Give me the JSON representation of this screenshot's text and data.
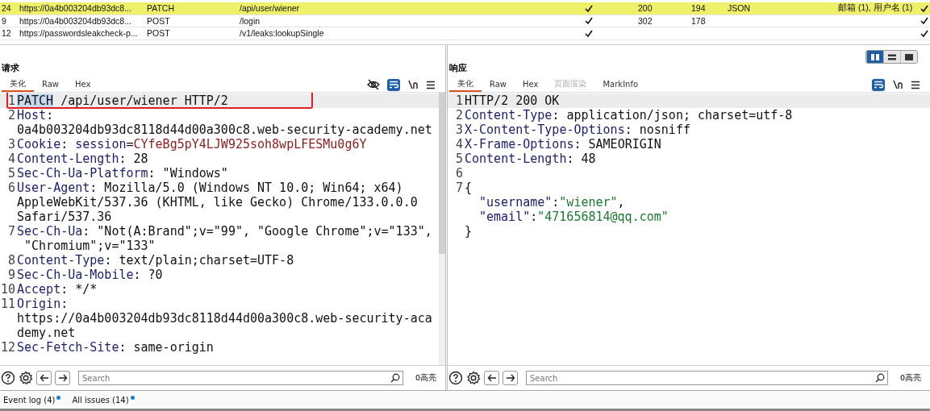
{
  "history": {
    "rows": [
      {
        "num": "24",
        "host": "https://0a4b003204db93dc8...",
        "method": "PATCH",
        "url": "/api/user/wiener",
        "edited": true,
        "status": "200",
        "length": "194",
        "mime": "JSON",
        "notes": "邮箱 (1), 用户名 (1)",
        "scoped": true,
        "selected": true
      },
      {
        "num": "9",
        "host": "https://0a4b003204db93dc8...",
        "method": "POST",
        "url": "/login",
        "edited": true,
        "status": "302",
        "length": "178",
        "mime": "",
        "notes": "",
        "scoped": true,
        "selected": false
      },
      {
        "num": "12",
        "host": "https://passwordsleakcheck-p...",
        "method": "POST",
        "url": "/v1/leaks:lookupSingle",
        "edited": true,
        "status": "",
        "length": "",
        "mime": "",
        "notes": "",
        "scoped": true,
        "selected": false
      }
    ]
  },
  "request": {
    "title": "请求",
    "tabs": [
      {
        "label": "美化",
        "selected": true,
        "disabled": false
      },
      {
        "label": "Raw",
        "selected": false,
        "disabled": false
      },
      {
        "label": "Hex",
        "selected": false,
        "disabled": false
      }
    ],
    "show_hidden_toggle": true,
    "wrap_on": true,
    "lines": [
      {
        "n": "1",
        "current": true,
        "parts": [
          {
            "kind": "selected",
            "text": "PATCH"
          },
          {
            "kind": "plain",
            "text": " /api/user/wiener HTTP/2"
          }
        ]
      },
      {
        "n": "2",
        "parts": [
          {
            "kind": "key",
            "text": "Host"
          },
          {
            "kind": "plain",
            "text": ":"
          }
        ]
      },
      {
        "parts": [
          {
            "kind": "plain",
            "text": "0a4b003204db93dc8118d44d00a300c8.web-security-academy.net"
          }
        ]
      },
      {
        "n": "3",
        "parts": [
          {
            "kind": "key",
            "text": "Cookie"
          },
          {
            "kind": "plain",
            "text": ": "
          },
          {
            "kind": "key",
            "text": "session"
          },
          {
            "kind": "plain",
            "text": "="
          },
          {
            "kind": "cookie",
            "text": "CYfeBg5pY4LJW925soh8wpLFESMu0g6Y"
          }
        ]
      },
      {
        "n": "4",
        "parts": [
          {
            "kind": "key",
            "text": "Content-Length"
          },
          {
            "kind": "plain",
            "text": ": 28"
          }
        ]
      },
      {
        "n": "5",
        "parts": [
          {
            "kind": "key",
            "text": "Sec-Ch-Ua-Platform"
          },
          {
            "kind": "plain",
            "text": ": \"Windows\""
          }
        ]
      },
      {
        "n": "6",
        "parts": [
          {
            "kind": "key",
            "text": "User-Agent"
          },
          {
            "kind": "plain",
            "text": ": Mozilla/5.0 (Windows NT 10.0; Win64; x64)"
          }
        ]
      },
      {
        "parts": [
          {
            "kind": "plain",
            "text": "AppleWebKit/537.36 (KHTML, like Gecko) Chrome/133.0.0.0"
          }
        ]
      },
      {
        "parts": [
          {
            "kind": "plain",
            "text": "Safari/537.36"
          }
        ]
      },
      {
        "n": "7",
        "parts": [
          {
            "kind": "key",
            "text": "Sec-Ch-Ua"
          },
          {
            "kind": "plain",
            "text": ": \"Not(A:Brand\";v=\"99\", \"Google Chrome\";v=\"133\","
          }
        ]
      },
      {
        "parts": [
          {
            "kind": "plain",
            "text": " \"Chromium\";v=\"133\""
          }
        ]
      },
      {
        "n": "8",
        "parts": [
          {
            "kind": "key",
            "text": "Content-Type"
          },
          {
            "kind": "plain",
            "text": ": text/plain;charset=UTF-8"
          }
        ]
      },
      {
        "n": "9",
        "parts": [
          {
            "kind": "key",
            "text": "Sec-Ch-Ua-Mobile"
          },
          {
            "kind": "plain",
            "text": ": ?0"
          }
        ]
      },
      {
        "n": "10",
        "parts": [
          {
            "kind": "key",
            "text": "Accept"
          },
          {
            "kind": "plain",
            "text": ": */*"
          }
        ]
      },
      {
        "n": "11",
        "parts": [
          {
            "kind": "key",
            "text": "Origin"
          },
          {
            "kind": "plain",
            "text": ":"
          }
        ]
      },
      {
        "parts": [
          {
            "kind": "plain",
            "text": "https://0a4b003204db93dc8118d44d00a300c8.web-security-aca"
          }
        ]
      },
      {
        "parts": [
          {
            "kind": "plain",
            "text": "demy.net"
          }
        ]
      },
      {
        "n": "12",
        "parts": [
          {
            "kind": "key",
            "text": "Sec-Fetch-Site"
          },
          {
            "kind": "plain",
            "text": ": same-origin"
          }
        ]
      }
    ],
    "search": {
      "placeholder": "Search"
    },
    "matches": "0高亮"
  },
  "response": {
    "title": "响应",
    "tabs": [
      {
        "label": "美化",
        "selected": true,
        "disabled": false
      },
      {
        "label": "Raw",
        "selected": false,
        "disabled": false
      },
      {
        "label": "Hex",
        "selected": false,
        "disabled": false
      },
      {
        "label": "页面渲染",
        "selected": false,
        "disabled": true
      },
      {
        "label": "MarkInfo",
        "selected": false,
        "disabled": false
      }
    ],
    "wrap_on": true,
    "layout_modes": [
      {
        "kind": "columns",
        "selected": true
      },
      {
        "kind": "rows",
        "selected": false
      },
      {
        "kind": "single",
        "selected": false
      }
    ],
    "lines": [
      {
        "n": "1",
        "current": true,
        "parts": [
          {
            "kind": "plain",
            "text": "HTTP/2 200 OK"
          }
        ]
      },
      {
        "n": "2",
        "parts": [
          {
            "kind": "key",
            "text": "Content-Type"
          },
          {
            "kind": "plain",
            "text": ": application/json; charset=utf-8"
          }
        ]
      },
      {
        "n": "3",
        "parts": [
          {
            "kind": "key",
            "text": "X-Content-Type-Options"
          },
          {
            "kind": "plain",
            "text": ": nosniff"
          }
        ]
      },
      {
        "n": "4",
        "parts": [
          {
            "kind": "key",
            "text": "X-Frame-Options"
          },
          {
            "kind": "plain",
            "text": ": SAMEORIGIN"
          }
        ]
      },
      {
        "n": "5",
        "parts": [
          {
            "kind": "key",
            "text": "Content-Length"
          },
          {
            "kind": "plain",
            "text": ": 48"
          }
        ]
      },
      {
        "n": "6"
      },
      {
        "n": "7",
        "parts": [
          {
            "kind": "plain",
            "text": "{"
          }
        ]
      },
      {
        "indented": true,
        "parts": [
          {
            "kind": "key",
            "text": "\"username\""
          },
          {
            "kind": "plain",
            "text": ":"
          },
          {
            "kind": "string",
            "text": "\"wiener\""
          },
          {
            "kind": "plain",
            "text": ","
          }
        ]
      },
      {
        "indented": true,
        "parts": [
          {
            "kind": "key",
            "text": "\"email\""
          },
          {
            "kind": "plain",
            "text": ":"
          },
          {
            "kind": "string",
            "text": "\"471656814@qq.com\""
          }
        ]
      },
      {
        "parts": [
          {
            "kind": "plain",
            "text": "}"
          }
        ]
      }
    ],
    "search": {
      "placeholder": "Search"
    },
    "matches": "0高亮"
  },
  "status_bar": [
    {
      "label": "Event log (4)",
      "unread": true
    },
    {
      "label": "All issues (14)",
      "unread": true
    }
  ]
}
